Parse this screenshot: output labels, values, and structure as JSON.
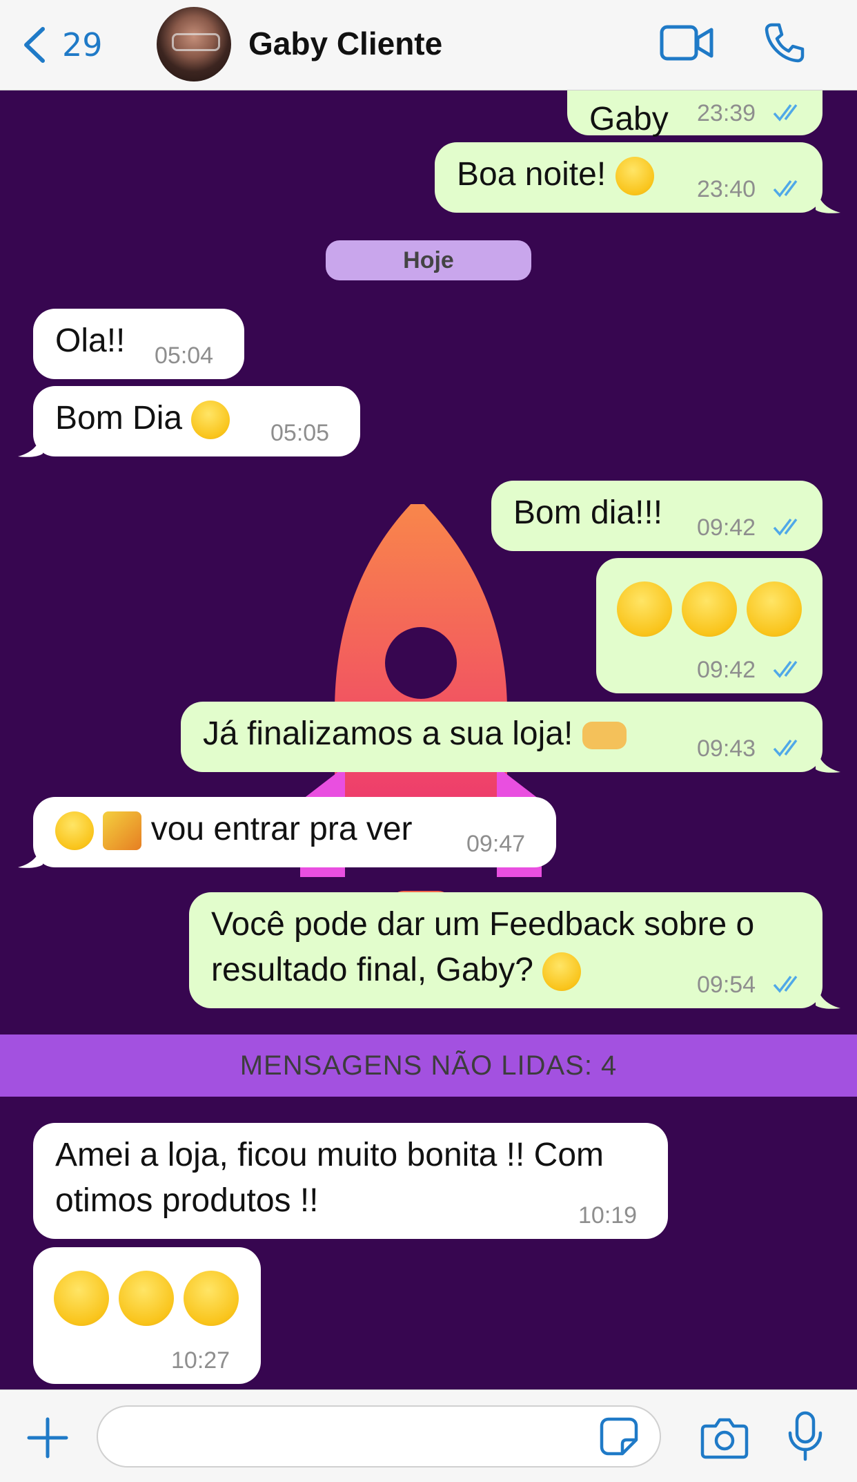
{
  "header": {
    "back_count": "29",
    "contact_name": "Gaby Cliente"
  },
  "date_divider": "Hoje",
  "unread_divider": "MENSAGENS NÃO LIDAS: 4",
  "messages": [
    {
      "text": "Gaby",
      "time": "23:39",
      "direction": "out",
      "status": "read"
    },
    {
      "text": "Boa noite!",
      "emoji_after": "grinning",
      "time": "23:40",
      "direction": "out",
      "status": "read"
    },
    {
      "text": "Ola!!",
      "time": "05:04",
      "direction": "in"
    },
    {
      "text": "Bom Dia",
      "emoji_after": "smiling",
      "time": "05:05",
      "direction": "in"
    },
    {
      "text": "Bom dia!!!",
      "time": "09:42",
      "direction": "out",
      "status": "read"
    },
    {
      "text": "",
      "emoji_only": [
        "grinning",
        "grinning",
        "grinning"
      ],
      "time": "09:42",
      "direction": "out",
      "status": "read"
    },
    {
      "text": "Já finalizamos a sua loja!",
      "emoji_after": "handshake",
      "time": "09:43",
      "direction": "out",
      "status": "read"
    },
    {
      "text": "vou entrar pra ver",
      "emoji_before": [
        "hugging",
        "party-popper"
      ],
      "time": "09:47",
      "direction": "in"
    },
    {
      "text_line1": "Você pode dar um Feedback sobre o",
      "text_line2": "resultado final, Gaby?",
      "emoji_after": "grinning",
      "time": "09:54",
      "direction": "out",
      "status": "read"
    },
    {
      "text_line1": "Amei a loja, ficou muito bonita !! Com",
      "text_line2": "otimos produtos !!",
      "time": "10:19",
      "direction": "in"
    },
    {
      "text": "",
      "emoji_only": [
        "hugging",
        "hugging",
        "hugging"
      ],
      "time": "10:27",
      "direction": "in"
    }
  ],
  "composer": {
    "placeholder": ""
  },
  "colors": {
    "chat_background": "#370650",
    "outgoing_bubble": "#e2fdcc",
    "incoming_bubble": "#ffffff",
    "accent": "#1f7ac7",
    "unread_bar": "#a351e0",
    "date_pill": "#c9a6ec",
    "read_ticks": "#4fa8e8"
  },
  "icons": [
    "chevron-left-icon",
    "video-camera-icon",
    "phone-icon",
    "plus-icon",
    "sticker-icon",
    "camera-icon",
    "microphone-icon"
  ]
}
